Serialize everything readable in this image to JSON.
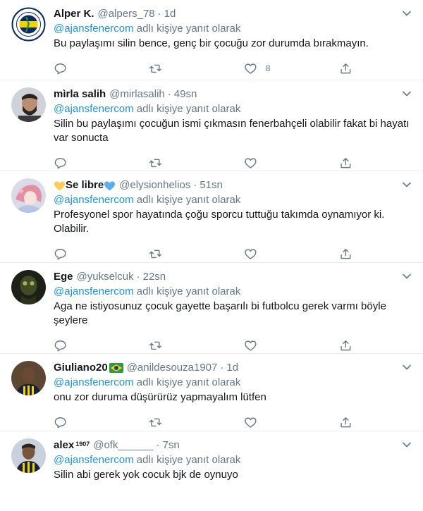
{
  "tweets": [
    {
      "avatar": "fenerbahce-crest-avatar",
      "name": "Alper K.",
      "name_suffix": "",
      "handle": "@alpers_78",
      "time": "1d",
      "reply_prefix": "",
      "reply_mention": "@ajansfenercom",
      "reply_suffix": " adlı kişiye yanıt olarak",
      "text": "Bu paylaşımı silin bence, genç bir çocuğu zor durumda bırakmayın.",
      "like_count": "8"
    },
    {
      "avatar": "bearded-man-avatar",
      "name": "mìrla salih",
      "name_suffix": "",
      "handle": "@mirlasalih",
      "time": "49sn",
      "reply_mention": "@ajansfenercom",
      "reply_suffix": " adlı kişiye yanıt olarak",
      "text": "Silin bu paylaşımı çocuğun ismi çıkmasın fenerbahçeli olabilir fakat bi hayatı\nvar sonucta",
      "like_count": ""
    },
    {
      "avatar": "anime-girl-avatar",
      "name": "Se libre",
      "name_suffix": "",
      "handle": "@elysionhelios",
      "time": "51sn",
      "reply_mention": "@ajansfenercom",
      "reply_suffix": " adlı kişiye yanıt olarak",
      "text": "Profesyonel spor hayatında çoğu sporcu tuttuğu takımda oynamıyor ki.\nOlabilir.",
      "like_count": ""
    },
    {
      "avatar": "dark-mask-avatar",
      "name": "Ege",
      "name_suffix": "",
      "handle": "@yukselcuk",
      "time": "22sn",
      "reply_mention": "@ajansfenercom",
      "reply_suffix": " adlı kişiye yanıt olarak",
      "text": "Aga ne istiyosunuz çocuk gayette başarılı bi futbolcu gerek varmı böyle\nşeylere",
      "like_count": ""
    },
    {
      "avatar": "footballer-avatar",
      "name": "Giuliano20",
      "name_suffix": "",
      "handle": "@anildesouza1907",
      "time": "1d",
      "reply_mention": "@ajansfenercom",
      "reply_suffix": " adlı kişiye yanıt olarak",
      "text": "onu zor duruma düşürürüz yapmayalım lütfen",
      "like_count": ""
    },
    {
      "avatar": "footballer-jersey-avatar",
      "name": "alex",
      "name_suffix": "1907",
      "handle": "@ofk______",
      "time": "7sn",
      "reply_mention": "@ajansfenercom",
      "reply_suffix": " adlı kişiye yanıt olarak",
      "text": "Silin abi gerek yok cocuk bjk de oynuyo",
      "like_count": ""
    }
  ],
  "icons": {
    "reply": "reply-icon",
    "retweet": "retweet-icon",
    "like": "like-icon",
    "share": "share-icon",
    "caret": "chevron-down-icon"
  },
  "colors": {
    "mention": "#1b95e0",
    "muted": "#657786",
    "divider": "#e6ecf0"
  }
}
